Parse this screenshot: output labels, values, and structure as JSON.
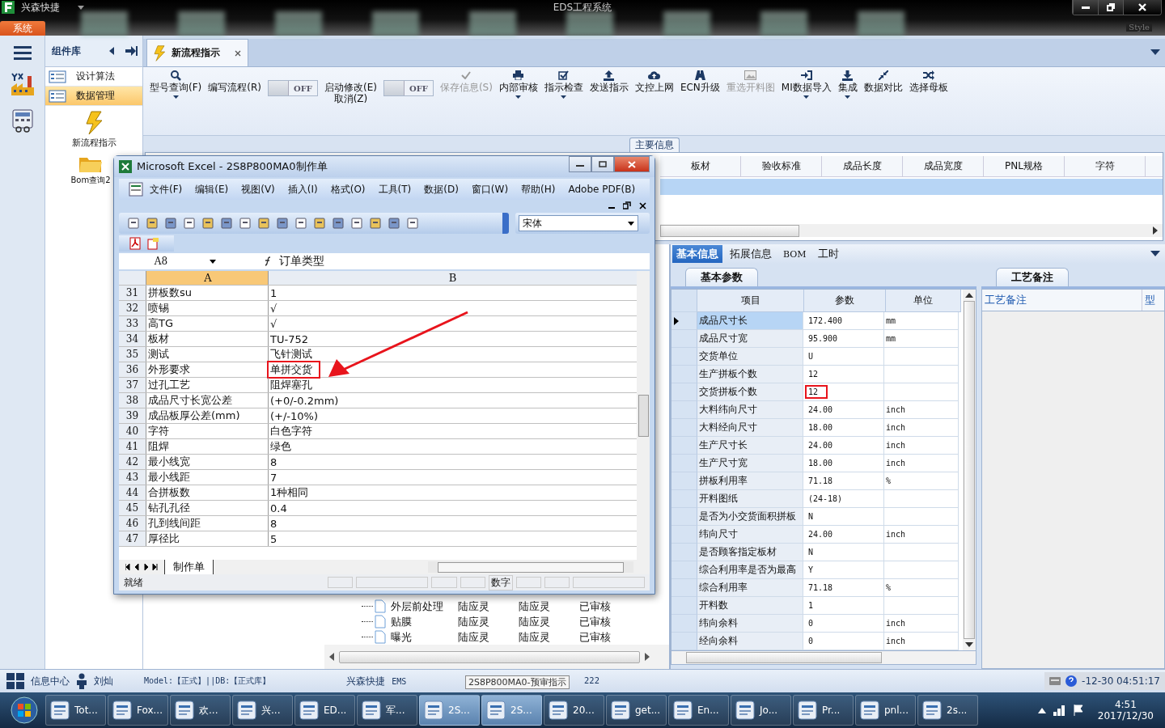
{
  "titlebar": {
    "app_name": "兴森快捷",
    "title": "EDS工程系统",
    "menu_tab": "系统",
    "style_label": "Style"
  },
  "components": {
    "title": "组件库",
    "nav_items": [
      {
        "label": "设计算法",
        "selected": false
      },
      {
        "label": "数据管理",
        "selected": true
      }
    ],
    "shortcuts": [
      "新流程指示",
      "Bom查询2"
    ]
  },
  "document_tab": "新流程指示",
  "ribbon": [
    {
      "kind": "button",
      "label": "型号查询(F)",
      "dropdown": true,
      "disabled": false
    },
    {
      "kind": "button",
      "label": "编写流程(R)",
      "dropdown": false,
      "disabled": false
    },
    {
      "kind": "toggle",
      "label": "OFF",
      "on": false
    },
    {
      "kind": "button",
      "label": "启动修改(E)\n取消(Z)",
      "dropdown": false,
      "disabled": false
    },
    {
      "kind": "toggle",
      "label": "OFF",
      "on": false
    },
    {
      "kind": "button",
      "label": "保存信息(S)",
      "dropdown": false,
      "disabled": true
    },
    {
      "kind": "button",
      "label": "内部审核",
      "dropdown": true,
      "disabled": false
    },
    {
      "kind": "button",
      "label": "指示检查",
      "dropdown": true,
      "disabled": false
    },
    {
      "kind": "button",
      "label": "发送指示",
      "dropdown": false,
      "disabled": false
    },
    {
      "kind": "button",
      "label": "文控上网",
      "dropdown": false,
      "disabled": false
    },
    {
      "kind": "button",
      "label": "ECN升级",
      "dropdown": false,
      "disabled": false
    },
    {
      "kind": "button",
      "label": "重选开料图",
      "dropdown": false,
      "disabled": true
    },
    {
      "kind": "button",
      "label": "MI数据导入",
      "dropdown": true,
      "disabled": false
    },
    {
      "kind": "button",
      "label": "集成",
      "dropdown": true,
      "disabled": false
    },
    {
      "kind": "button",
      "label": "数据对比",
      "dropdown": false,
      "disabled": false
    },
    {
      "kind": "button",
      "label": "选择母板",
      "dropdown": false,
      "disabled": false
    }
  ],
  "group_label": "主要信息",
  "main_grid": {
    "columns": [
      "板材",
      "验收标准",
      "成品长度",
      "成品宽度",
      "PNL规格",
      "字符"
    ],
    "rows": [
      {
        "selected": true
      }
    ]
  },
  "process_tree": {
    "rows": [
      {
        "name": "外层前处理",
        "cells": [
          "陆应灵",
          "陆应灵",
          "已审核"
        ]
      },
      {
        "name": "贴膜",
        "cells": [
          "陆应灵",
          "陆应灵",
          "已审核"
        ]
      },
      {
        "name": "曝光",
        "cells": [
          "陆应灵",
          "陆应灵",
          "已审核"
        ]
      }
    ]
  },
  "detail_tabs": [
    {
      "label": "基本信息",
      "selected": true
    },
    {
      "label": "拓展信息",
      "selected": false
    },
    {
      "label": "BOM",
      "selected": false
    },
    {
      "label": "工时",
      "selected": false
    }
  ],
  "parameters": {
    "tab": "基本参数",
    "columns": [
      "项目",
      "参数",
      "单位"
    ],
    "rows": [
      {
        "item": "成品尺寸长",
        "value": "172.400",
        "unit": "mm",
        "current": true,
        "highlighted": false
      },
      {
        "item": "成品尺寸宽",
        "value": "95.900",
        "unit": "mm",
        "current": false,
        "highlighted": false
      },
      {
        "item": "交货单位",
        "value": "U",
        "current": false,
        "highlighted": false
      },
      {
        "item": "生产拼板个数",
        "value": "12",
        "current": false,
        "highlighted": false
      },
      {
        "item": "交货拼板个数",
        "value": "12",
        "current": false,
        "highlighted": true
      },
      {
        "item": "大料纬向尺寸",
        "value": "24.00",
        "unit": "inch",
        "current": false,
        "highlighted": false
      },
      {
        "item": "大料经向尺寸",
        "value": "18.00",
        "unit": "inch",
        "current": false,
        "highlighted": false
      },
      {
        "item": "生产尺寸长",
        "value": "24.00",
        "unit": "inch",
        "current": false,
        "highlighted": false
      },
      {
        "item": "生产尺寸宽",
        "value": "18.00",
        "unit": "inch",
        "current": false,
        "highlighted": false
      },
      {
        "item": "拼板利用率",
        "value": "71.18",
        "unit": "%",
        "current": false,
        "highlighted": false
      },
      {
        "item": "开料图纸",
        "value": "(24-18)",
        "current": false,
        "highlighted": false
      },
      {
        "item": "是否为小交货面积拼板",
        "value": "N",
        "current": false,
        "highlighted": false
      },
      {
        "item": "纬向尺寸",
        "value": "24.00",
        "unit": "inch",
        "current": false,
        "highlighted": false
      },
      {
        "item": "是否顾客指定板材",
        "value": "N",
        "current": false,
        "highlighted": false
      },
      {
        "item": "综合利用率是否为最高",
        "value": "Y",
        "current": false,
        "highlighted": false
      },
      {
        "item": "综合利用率",
        "value": "71.18",
        "unit": "%",
        "current": false,
        "highlighted": false
      },
      {
        "item": "开料数",
        "value": "1",
        "current": false,
        "highlighted": false
      },
      {
        "item": "纬向余料",
        "value": "0",
        "unit": "inch",
        "current": false,
        "highlighted": false
      },
      {
        "item": "经向余料",
        "value": "0",
        "unit": "inch",
        "current": false,
        "highlighted": false
      }
    ]
  },
  "notes": {
    "tab": "工艺备注",
    "columns": [
      "工艺备注",
      "型"
    ]
  },
  "excel": {
    "title": "Microsoft Excel - 2S8P800MA0制作单",
    "menus": [
      "文件(F)",
      "编辑(E)",
      "视图(V)",
      "插入(I)",
      "格式(O)",
      "工具(T)",
      "数据(D)",
      "窗口(W)",
      "帮助(H)",
      "Adobe PDF(B)"
    ],
    "font": "宋体",
    "cell_ref": "A8",
    "formula": "订单类型",
    "columns": [
      "A",
      "B"
    ],
    "rows": [
      {
        "number": "31",
        "a": "拼板数su",
        "b": "1",
        "highlighted": false
      },
      {
        "number": "32",
        "a": "喷锡",
        "b": "√",
        "highlighted": false
      },
      {
        "number": "33",
        "a": "高TG",
        "b": "√",
        "highlighted": false
      },
      {
        "number": "34",
        "a": "板材",
        "b": "TU-752",
        "highlighted": false
      },
      {
        "number": "35",
        "a": "测试",
        "b": "飞针测试",
        "highlighted": false
      },
      {
        "number": "36",
        "a": "外形要求",
        "b": "单拼交货",
        "highlighted": true
      },
      {
        "number": "37",
        "a": "过孔工艺",
        "b": "阻焊塞孔",
        "highlighted": false
      },
      {
        "number": "38",
        "a": "成品尺寸长宽公差",
        "b": "(+0/-0.2mm)",
        "highlighted": false
      },
      {
        "number": "39",
        "a": "成品板厚公差(mm)",
        "b": "(+/-10%)",
        "highlighted": false
      },
      {
        "number": "40",
        "a": "字符",
        "b": "白色字符",
        "highlighted": false
      },
      {
        "number": "41",
        "a": "阻焊",
        "b": "绿色",
        "highlighted": false
      },
      {
        "number": "42",
        "a": "最小线宽",
        "b": "8",
        "highlighted": false
      },
      {
        "number": "43",
        "a": "最小线距",
        "b": "7",
        "highlighted": false
      },
      {
        "number": "44",
        "a": "合拼板数",
        "b": "1种相同",
        "highlighted": false
      },
      {
        "number": "45",
        "a": "钻孔孔径",
        "b": "0.4",
        "highlighted": false
      },
      {
        "number": "46",
        "a": "孔到线间距",
        "b": "8",
        "highlighted": false
      },
      {
        "number": "47",
        "a": "厚径比",
        "b": "5",
        "highlighted": false
      }
    ],
    "sheet_tabs": [
      {
        "label": "制作单",
        "selected": true
      }
    ],
    "status": "就绪",
    "indicator": "数字"
  },
  "statusbar": {
    "info_center": "信息中心",
    "user": "刘灿",
    "env": "Model:【正式】||DB:【正式库】",
    "company": "兴森快捷",
    "text": "EMS",
    "text_after": "222",
    "clock": "-12-30 04:51:17",
    "tooltip": "2S8P800MA0-预审指示"
  },
  "taskbar": {
    "items": [
      {
        "label": "Tot...",
        "selected": false
      },
      {
        "label": "Fox...",
        "selected": false
      },
      {
        "label": "欢...",
        "selected": false
      },
      {
        "label": "兴...",
        "selected": false
      },
      {
        "label": "ED...",
        "selected": false
      },
      {
        "label": "军...",
        "selected": false
      },
      {
        "label": "2S...",
        "selected": true
      },
      {
        "label": "2S...",
        "selected": true
      },
      {
        "label": "20...",
        "selected": false
      },
      {
        "label": "get...",
        "selected": false
      },
      {
        "label": "En...",
        "selected": false
      },
      {
        "label": "Jo...",
        "selected": false
      },
      {
        "label": "Pr...",
        "selected": false
      },
      {
        "label": "pnl...",
        "selected": false
      },
      {
        "label": "2s...",
        "selected": false
      }
    ],
    "time": "4:51",
    "date": "2017/12/30"
  }
}
